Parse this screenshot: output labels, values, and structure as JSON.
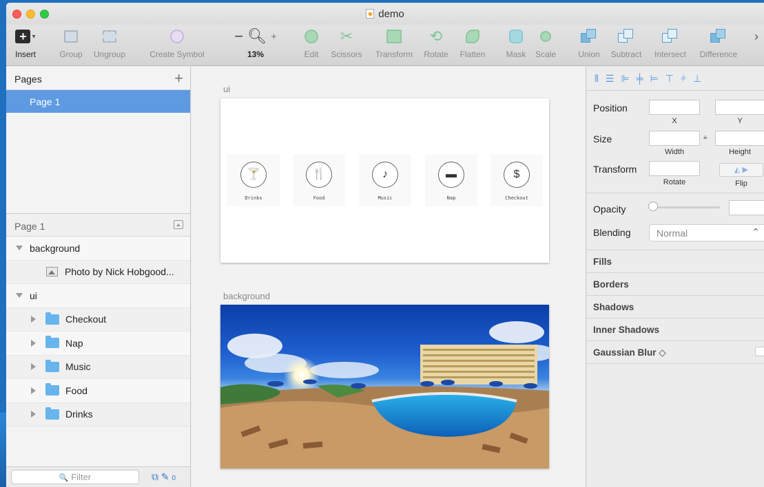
{
  "window": {
    "title": "demo"
  },
  "toolbar": {
    "insert": "Insert",
    "group": "Group",
    "ungroup": "Ungroup",
    "create_symbol": "Create Symbol",
    "zoom_minus": "−",
    "zoom_plus": "+",
    "zoom_level": "13%",
    "edit": "Edit",
    "scissors": "Scissors",
    "transform": "Transform",
    "rotate": "Rotate",
    "flatten": "Flatten",
    "mask": "Mask",
    "scale": "Scale",
    "union": "Union",
    "subtract": "Subtract",
    "intersect": "Intersect",
    "difference": "Difference",
    "overflow": "›"
  },
  "pages": {
    "header": "Pages",
    "add": "+",
    "items": [
      {
        "label": "Page 1"
      }
    ]
  },
  "layers": {
    "header": "Page 1",
    "groups": [
      {
        "label": "background",
        "children": [
          {
            "label": "Photo by Nick Hobgood..."
          }
        ]
      },
      {
        "label": "ui",
        "children": [
          {
            "label": "Checkout"
          },
          {
            "label": "Nap"
          },
          {
            "label": "Music"
          },
          {
            "label": "Food"
          },
          {
            "label": "Drinks"
          }
        ]
      }
    ],
    "filter_placeholder": "Filter",
    "filter_icon": "🔍",
    "filter_count": "0"
  },
  "canvas": {
    "artboards": [
      {
        "label": "ui",
        "nav": [
          {
            "label": "Drinks",
            "glyph": "🍸"
          },
          {
            "label": "Food",
            "glyph": "🍴"
          },
          {
            "label": "Music",
            "glyph": "♪"
          },
          {
            "label": "Nap",
            "glyph": "▬"
          },
          {
            "label": "Checkout",
            "glyph": "$"
          }
        ]
      },
      {
        "label": "background"
      }
    ]
  },
  "inspector": {
    "position": "Position",
    "x": "X",
    "y": "Y",
    "size": "Size",
    "width": "Width",
    "height": "Height",
    "transform": "Transform",
    "rotate": "Rotate",
    "flip": "Flip",
    "opacity": "Opacity",
    "blending": "Blending",
    "blending_value": "Normal",
    "sections": [
      "Fills",
      "Borders",
      "Shadows",
      "Inner Shadows",
      "Gaussian Blur ◇"
    ]
  },
  "colors": {
    "selection": "#5e9ae2",
    "folder": "#67b5ec"
  }
}
